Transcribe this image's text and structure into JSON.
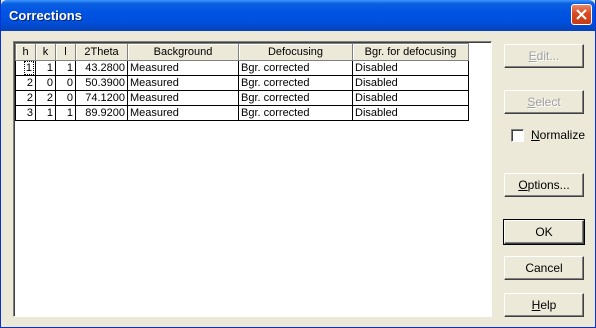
{
  "window": {
    "title": "Corrections"
  },
  "table": {
    "columns": [
      "h",
      "k",
      "l",
      "2Theta",
      "Background",
      "Defocusing",
      "Bgr. for defocusing"
    ],
    "rows": [
      [
        "1",
        "1",
        "1",
        "43.2800",
        "Measured",
        "Bgr. corrected",
        "Disabled"
      ],
      [
        "2",
        "0",
        "0",
        "50.3900",
        "Measured",
        "Bgr. corrected",
        "Disabled"
      ],
      [
        "2",
        "2",
        "0",
        "74.1200",
        "Measured",
        "Bgr. corrected",
        "Disabled"
      ],
      [
        "3",
        "1",
        "1",
        "89.9200",
        "Measured",
        "Bgr. corrected",
        "Disabled"
      ]
    ]
  },
  "buttons": {
    "edit": {
      "pre": "",
      "u": "E",
      "post": "dit..."
    },
    "select": {
      "pre": "",
      "u": "S",
      "post": "elect"
    },
    "options": {
      "pre": "",
      "u": "O",
      "post": "ptions..."
    },
    "ok": {
      "pre": "OK",
      "u": "",
      "post": ""
    },
    "cancel": {
      "pre": "Cancel",
      "u": "",
      "post": ""
    },
    "help": {
      "pre": "",
      "u": "H",
      "post": "elp"
    }
  },
  "normalize": {
    "u": "N",
    "post": "ormalize",
    "checked": false
  },
  "colors": {
    "title_bar": "#0050dd",
    "dialog_bg": "#ece9d8",
    "close_button": "#d84a21"
  }
}
